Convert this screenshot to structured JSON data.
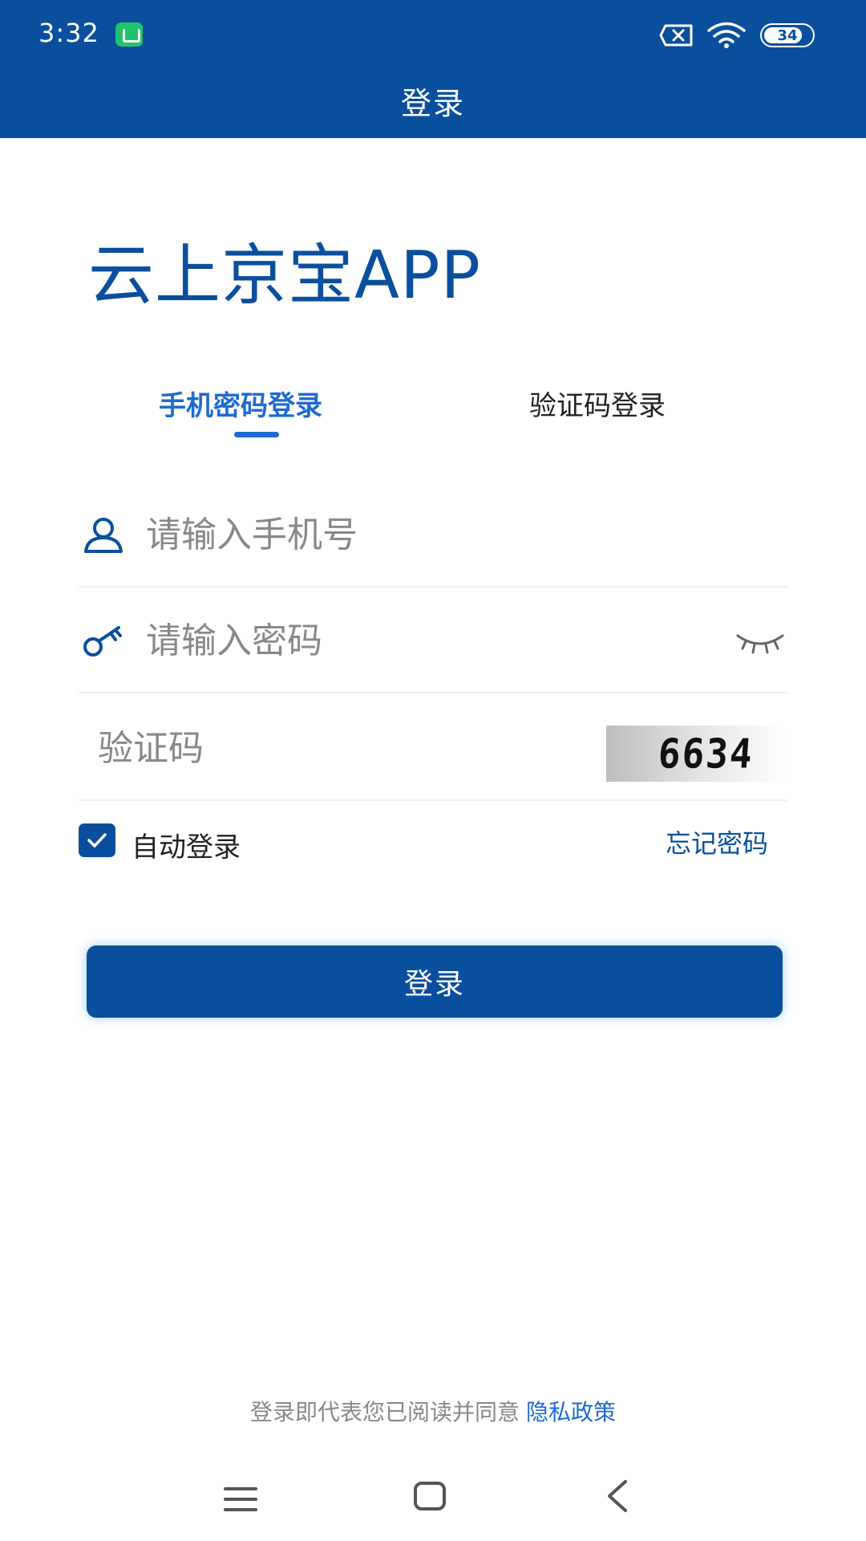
{
  "status_bar": {
    "time": "3:32",
    "battery": "34",
    "icons": [
      "notification-app-icon",
      "sim-error-icon",
      "wifi-icon",
      "battery-icon"
    ]
  },
  "header": {
    "title": "登录"
  },
  "brand": {
    "title": "云上京宝APP"
  },
  "tabs": [
    {
      "label": "手机密码登录",
      "active": true
    },
    {
      "label": "验证码登录",
      "active": false
    }
  ],
  "form": {
    "phone": {
      "placeholder": "请输入手机号",
      "value": ""
    },
    "password": {
      "placeholder": "请输入密码",
      "value": ""
    },
    "captcha": {
      "placeholder": "验证码",
      "value": "",
      "image_text": "6634"
    }
  },
  "options": {
    "auto_login_label": "自动登录",
    "auto_login_checked": true,
    "forgot_label": "忘记密码"
  },
  "login_button": {
    "label": "登录"
  },
  "footer": {
    "agreement_text": "登录即代表您已阅读并同意",
    "privacy_link": "隐私政策"
  },
  "colors": {
    "primary": "#0a4f9e",
    "accent": "#1e6ad4",
    "notification": "#1fc46a"
  }
}
